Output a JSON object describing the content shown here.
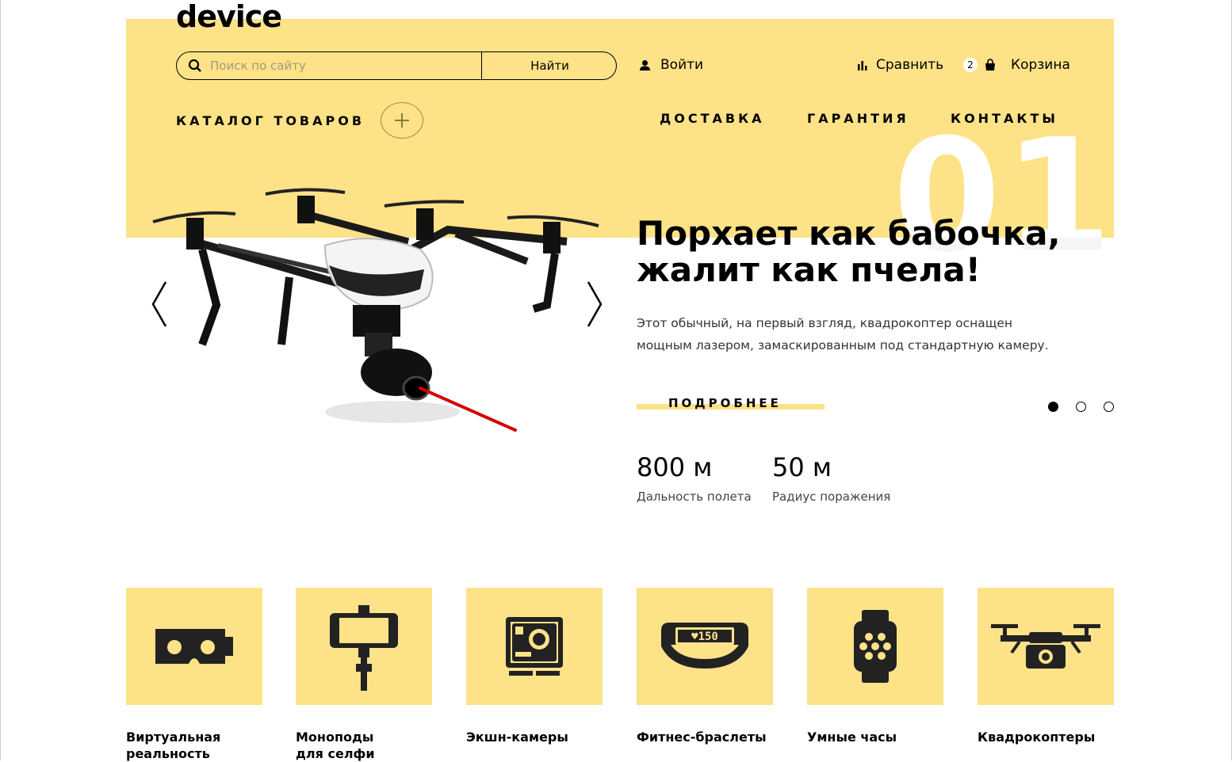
{
  "brand": {
    "logo_text": "device"
  },
  "search": {
    "placeholder": "Поиск по сайту",
    "button_label": "Найти"
  },
  "header": {
    "login_label": "Войти",
    "compare_label": "Сравнить",
    "cart_label": "Корзина",
    "cart_count": "2"
  },
  "nav": {
    "catalog_label": "КАТАЛОГ ТОВАРОВ",
    "delivery": "ДОСТАВКА",
    "warranty": "ГАРАНТИЯ",
    "contacts": "КОНТАКТЫ"
  },
  "slider": {
    "number": "01",
    "headline_line1": "Порхает как бабочка,",
    "headline_line2": "жалит как пчела!",
    "desc_line1": "Этот обычный, на первый взгляд, квадрокоптер оснащен",
    "desc_line2": "мощным лазером, замаскированным под стандартную камеру.",
    "more_label": "ПОДРОБНЕЕ",
    "active_slide": 1,
    "stats": [
      {
        "value": "800 м",
        "label": "Дальность полета"
      },
      {
        "value": "50 м",
        "label": "Радиус поражения"
      }
    ]
  },
  "categories": [
    {
      "line1": "Виртуальная",
      "line2": "реальность",
      "icon": "vr-headset-icon"
    },
    {
      "line1": "Моноподы",
      "line2": "для селфи",
      "icon": "selfie-stick-icon"
    },
    {
      "line1": "Экшн-камеры",
      "line2": "",
      "icon": "action-camera-icon"
    },
    {
      "line1": "Фитнес-браслеты",
      "line2": "",
      "icon": "fitness-band-icon"
    },
    {
      "line1": "Умные часы",
      "line2": "",
      "icon": "smart-watch-icon"
    },
    {
      "line1": "Квадрокоптеры",
      "line2": "",
      "icon": "quadcopter-icon"
    }
  ],
  "band_display": "♥150",
  "colors": {
    "accent": "#fee288",
    "text": "#000000",
    "laser": "#d40000"
  }
}
